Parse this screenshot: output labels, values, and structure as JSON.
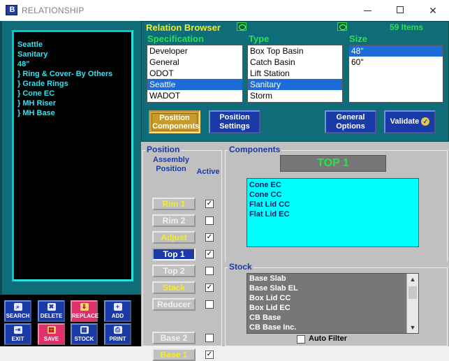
{
  "window": {
    "title": "RELATIONSHIP",
    "minimize_glyph": "",
    "maximize_glyph": "",
    "close_glyph": "✕"
  },
  "left_panel": {
    "lines": [
      "Seattle",
      "Sanitary",
      "48\"",
      "} Ring & Cover- By Others",
      "} Grade Rings",
      "} Cone EC",
      "} MH Riser",
      "} MH Base"
    ]
  },
  "toolbar": {
    "search": "SEARCH",
    "delete": "DELETE",
    "replace": "REPLACE",
    "add": "ADD",
    "exit": "EXIT",
    "save": "SAVE",
    "stock": "STOCK",
    "print": "PRINT"
  },
  "relation_browser": {
    "title": "Relation Browser",
    "count": "59 Items",
    "specification": {
      "label": "Specification",
      "items": [
        "Developer",
        "General",
        "ODOT",
        "Seattle",
        "WADOT"
      ],
      "selected": "Seattle"
    },
    "type": {
      "label": "Type",
      "items": [
        "Box Top Basin",
        "Catch Basin",
        "Lift Station",
        "Sanitary",
        "Storm"
      ],
      "selected": "Sanitary"
    },
    "size": {
      "label": "Size",
      "items": [
        "48\"",
        "60\""
      ],
      "selected": "48\""
    },
    "buttons": {
      "position_components": "Position Components",
      "position_settings": "Position Settings",
      "general_options": "General Options",
      "validate": "Validate"
    }
  },
  "position_panel": {
    "title": "Position",
    "header_assembly": "Assembly Position",
    "header_active": "Active",
    "rows": [
      {
        "label": "Rim 1",
        "checked": true,
        "enabled": true
      },
      {
        "label": "Rim 2",
        "checked": false,
        "enabled": false
      },
      {
        "label": "Adjust",
        "checked": true,
        "enabled": true
      },
      {
        "label": "Top 1",
        "checked": true,
        "enabled": true,
        "selected": true
      },
      {
        "label": "Top 2",
        "checked": false,
        "enabled": false
      },
      {
        "label": "Stack",
        "checked": true,
        "enabled": true
      },
      {
        "label": "Reducer",
        "checked": false,
        "enabled": false
      },
      {
        "label": "Base 2",
        "checked": false,
        "enabled": false
      },
      {
        "label": "Base 1",
        "checked": true,
        "enabled": true
      }
    ]
  },
  "components_panel": {
    "title": "Components",
    "current": "TOP 1",
    "items": [
      "Cone EC",
      "Cone CC",
      "Flat Lid CC",
      "Flat Lid EC"
    ]
  },
  "stock_panel": {
    "title": "Stock",
    "items": [
      "Base Slab",
      "Base Slab EL",
      "Box Lid CC",
      "Box Lid EC",
      "CB Base",
      "CB Base Inc."
    ],
    "auto_filter_label": "Auto Filter",
    "auto_filter_checked": false
  },
  "colors": {
    "panel_teal": "#0f6d7a",
    "label_yellow": "#f3ec29",
    "label_green": "#2de04a",
    "button_blue": "#1a3aa8",
    "list_cyan": "#00ffff",
    "selection_blue": "#1c6bd6"
  }
}
